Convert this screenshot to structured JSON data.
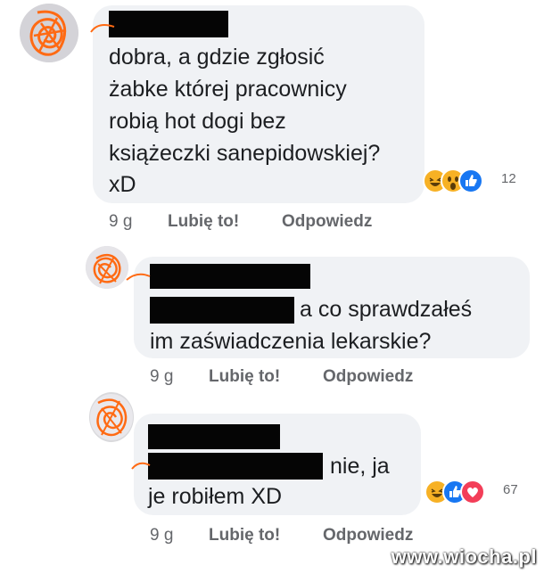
{
  "comments": [
    {
      "text_lines": [
        "dobra, a gdzie zgłosić",
        "żabke której pracownicy",
        "robią hot dogi bez",
        "książeczki sanepidowskiej?",
        "xD"
      ],
      "time": "9 g",
      "like_label": "Lubię to!",
      "reply_label": "Odpowiedz",
      "reaction_count": "12",
      "reaction_icons": [
        "haha-icon",
        "wow-icon",
        "like-icon"
      ]
    },
    {
      "text_line_1": "a co sprawdzałeś",
      "text_line_2": "im zaświadczenia lekarskie?",
      "time": "9 g",
      "like_label": "Lubię to!",
      "reply_label": "Odpowiedz"
    },
    {
      "text_line_1": "nie, ja",
      "text_line_2": "je robiłem XD",
      "time": "9 g",
      "like_label": "Lubię to!",
      "reply_label": "Odpowiedz",
      "reaction_count": "67",
      "reaction_icons": [
        "haha-icon",
        "like-icon",
        "love-icon"
      ]
    }
  ],
  "watermark": "www.wiocha.pl",
  "colors": {
    "bubble": "#f0f2f5",
    "meta_text": "#65676b",
    "like_blue": "#1877f2",
    "love_red": "#f33e58",
    "haha_yellow": "#f7b125",
    "scribble_orange": "#ff6a13"
  }
}
